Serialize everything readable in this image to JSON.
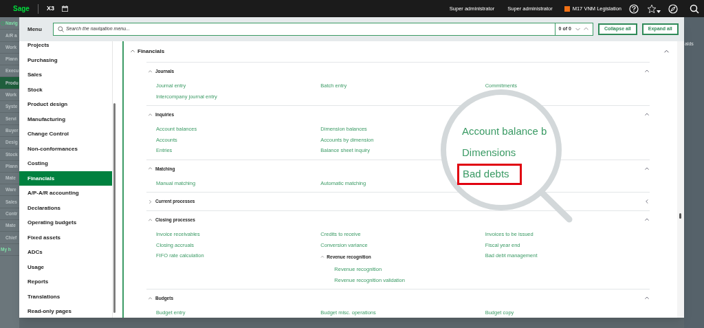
{
  "top_bar": {
    "logo": "Sage",
    "product": "X3",
    "user_1": "Super administrator",
    "user_2": "Super administrator",
    "legislation": "M17 VNM Legislation"
  },
  "background_menu": [
    {
      "label": "Navig",
      "kind": "header",
      "selected": false
    },
    {
      "label": "A/R a",
      "kind": "item",
      "selected": false
    },
    {
      "label": "Work",
      "kind": "item",
      "selected": false
    },
    {
      "label": "Plann",
      "kind": "item",
      "selected": false
    },
    {
      "label": "Execu",
      "kind": "item",
      "selected": false
    },
    {
      "label": "Produ",
      "kind": "item",
      "selected": true
    },
    {
      "label": "Work",
      "kind": "item",
      "selected": false
    },
    {
      "label": "Syste",
      "kind": "item",
      "selected": false
    },
    {
      "label": "Servi",
      "kind": "item",
      "selected": false
    },
    {
      "label": "Buyer",
      "kind": "item",
      "selected": false
    },
    {
      "label": "Desig",
      "kind": "item",
      "selected": false
    },
    {
      "label": "Stock",
      "kind": "item",
      "selected": false
    },
    {
      "label": "Plann",
      "kind": "item",
      "selected": false
    },
    {
      "label": "Mate",
      "kind": "item",
      "selected": false
    },
    {
      "label": "Ware",
      "kind": "item",
      "selected": false
    },
    {
      "label": "Sales",
      "kind": "item",
      "selected": false
    },
    {
      "label": "Contr",
      "kind": "item",
      "selected": false
    },
    {
      "label": "Mate",
      "kind": "item",
      "selected": false
    },
    {
      "label": "Chief",
      "kind": "item",
      "selected": false
    },
    {
      "label": "My h",
      "kind": "home",
      "selected": false
    }
  ],
  "background_right_text": "alds",
  "menu": {
    "title": "Menu",
    "search": {
      "placeholder": "Search the navigation menu...",
      "count": "0 of 0"
    },
    "collapse_button": "Collapse all",
    "expand_button": "Expand all"
  },
  "nav_items": [
    {
      "label": "Projects",
      "selected": false
    },
    {
      "label": "Purchasing",
      "selected": false
    },
    {
      "label": "Sales",
      "selected": false
    },
    {
      "label": "Stock",
      "selected": false
    },
    {
      "label": "Product design",
      "selected": false
    },
    {
      "label": "Manufacturing",
      "selected": false
    },
    {
      "label": "Change Control",
      "selected": false
    },
    {
      "label": "Non-conformances",
      "selected": false
    },
    {
      "label": "Costing",
      "selected": false
    },
    {
      "label": "Financials",
      "selected": true
    },
    {
      "label": "A/P-A/R accounting",
      "selected": false
    },
    {
      "label": "Declarations",
      "selected": false
    },
    {
      "label": "Operating budgets",
      "selected": false
    },
    {
      "label": "Fixed assets",
      "selected": false
    },
    {
      "label": "ADCs",
      "selected": false
    },
    {
      "label": "Usage",
      "selected": false
    },
    {
      "label": "Reports",
      "selected": false
    },
    {
      "label": "Translations",
      "selected": false
    },
    {
      "label": "Read-only pages",
      "selected": false
    }
  ],
  "content": {
    "title": "Financials",
    "expanded": true,
    "sections": [
      {
        "title": "Journals",
        "expanded": true,
        "columns": [
          [
            {
              "kind": "link",
              "label": "Journal entry"
            },
            {
              "kind": "link",
              "label": "Intercompany journal entry"
            }
          ],
          [
            {
              "kind": "link",
              "label": "Batch entry"
            }
          ],
          [
            {
              "kind": "link",
              "label": "Commitments"
            }
          ]
        ]
      },
      {
        "title": "Inquiries",
        "expanded": true,
        "columns": [
          [
            {
              "kind": "link",
              "label": "Account balances"
            },
            {
              "kind": "link",
              "label": "Accounts"
            },
            {
              "kind": "link",
              "label": "Entries"
            }
          ],
          [
            {
              "kind": "link",
              "label": "Dimension balances"
            },
            {
              "kind": "link",
              "label": "Accounts by dimension"
            },
            {
              "kind": "link",
              "label": "Balance sheet inquiry"
            }
          ],
          []
        ]
      },
      {
        "title": "Matching",
        "expanded": true,
        "columns": [
          [
            {
              "kind": "link",
              "label": "Manual matching"
            }
          ],
          [
            {
              "kind": "link",
              "label": "Automatic matching"
            }
          ],
          []
        ]
      },
      {
        "title": "Current processes",
        "expanded": false
      },
      {
        "title": "Closing processes",
        "expanded": true,
        "columns": [
          [
            {
              "kind": "link",
              "label": "Invoice receivables"
            },
            {
              "kind": "link",
              "label": "Closing accruals"
            },
            {
              "kind": "link",
              "label": "FIFO rate calculation"
            }
          ],
          [
            {
              "kind": "link",
              "label": "Credits to receive"
            },
            {
              "kind": "link",
              "label": "Conversion variance"
            },
            {
              "kind": "group",
              "label": "Revenue recognition",
              "expanded": true,
              "children": [
                {
                  "kind": "link",
                  "label": "Revenue recognition"
                },
                {
                  "kind": "link",
                  "label": "Revenue recognition validation"
                }
              ]
            }
          ],
          [
            {
              "kind": "link",
              "label": "Invoices to be issued"
            },
            {
              "kind": "link",
              "label": "Fiscal year end"
            },
            {
              "kind": "link",
              "label": "Bad debt management"
            }
          ]
        ]
      },
      {
        "title": "Budgets",
        "expanded": true,
        "columns": [
          [
            {
              "kind": "link",
              "label": "Budget entry"
            }
          ],
          [
            {
              "kind": "link",
              "label": "Budget misc. operations"
            }
          ],
          [
            {
              "kind": "link",
              "label": "Budget copy"
            }
          ]
        ]
      }
    ]
  },
  "magnifier": {
    "lines": [
      {
        "label": "Account balance b",
        "highlighted": false
      },
      {
        "label": "Dimensions",
        "highlighted": false
      },
      {
        "label": "Bad debts",
        "highlighted": true
      }
    ]
  }
}
